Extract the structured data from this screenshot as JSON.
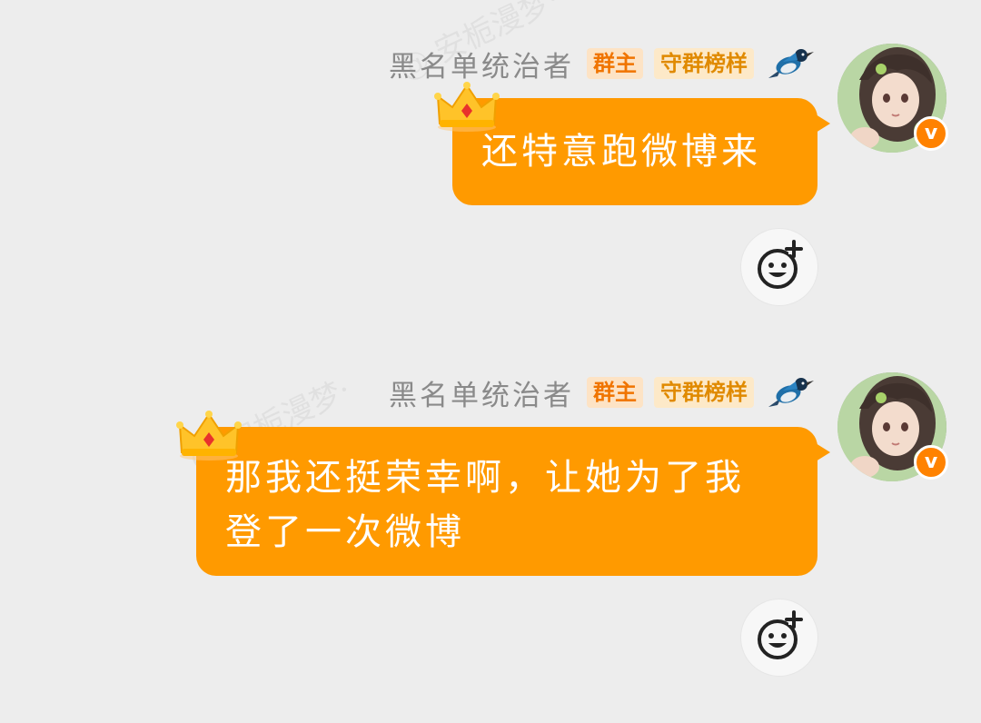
{
  "watermark": "@·安栀漫梦·",
  "messages": [
    {
      "sender_name": "黑名单统治者",
      "badge_owner": "群主",
      "badge_guard": "守群榜样",
      "text": "还特意跑微博来",
      "avatar_badge": "v"
    },
    {
      "sender_name": "黑名单统治者",
      "badge_owner": "群主",
      "badge_guard": "守群榜样",
      "text_line1": "那我还挺荣幸啊，让她为了我",
      "text_line2": "登了一次微博",
      "avatar_badge": "v"
    }
  ],
  "colors": {
    "bubble": "#ff9a00",
    "background": "#ededed",
    "badge_owner_text": "#f07400",
    "badge_guard_text": "#e08a00"
  }
}
